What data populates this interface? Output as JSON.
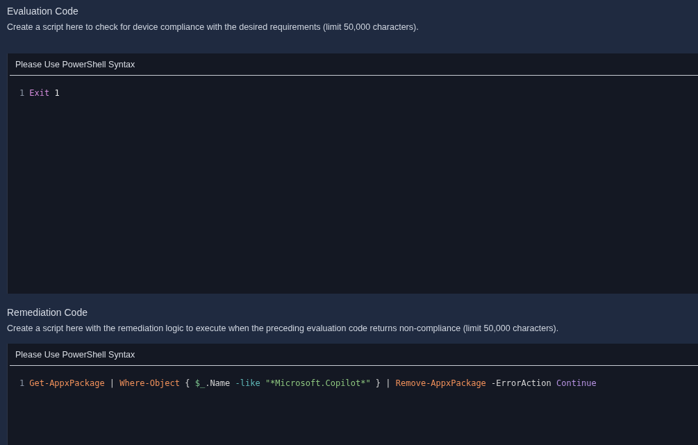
{
  "sections": [
    {
      "title": "Evaluation Code",
      "description": "Create a script here to check for device compliance with the desired requirements (limit 50,000 characters).",
      "editor": {
        "header": "Please Use PowerShell Syntax",
        "lines": [
          {
            "number": "1",
            "words": [
              [
                {
                  "kind": "keyword",
                  "text": "Exit"
                }
              ],
              [
                {
                  "kind": "number",
                  "text": "1"
                }
              ]
            ]
          }
        ]
      }
    },
    {
      "title": "Remediation Code",
      "description": "Create a script here with the remediation logic to execute when the preceding evaluation code returns non-compliance (limit 50,000 characters).",
      "editor": {
        "header": "Please Use PowerShell Syntax",
        "lines": [
          {
            "number": "1",
            "words": [
              [
                {
                  "kind": "cmdlet",
                  "text": "Get-AppxPackage"
                }
              ],
              [
                {
                  "kind": "plain",
                  "text": "|"
                }
              ],
              [
                {
                  "kind": "cmdlet",
                  "text": "Where-Object"
                }
              ],
              [
                {
                  "kind": "plain",
                  "text": "{"
                }
              ],
              [
                {
                  "kind": "variable",
                  "text": "$_"
                },
                {
                  "kind": "plain",
                  "text": ".Name"
                }
              ],
              [
                {
                  "kind": "operator",
                  "text": "-like"
                }
              ],
              [
                {
                  "kind": "string",
                  "text": "\"*Microsoft.Copilot*\""
                }
              ],
              [
                {
                  "kind": "plain",
                  "text": "}"
                }
              ],
              [
                {
                  "kind": "plain",
                  "text": "|"
                }
              ],
              [
                {
                  "kind": "cmdlet",
                  "text": "Remove-AppxPackage"
                }
              ],
              [
                {
                  "kind": "plain",
                  "text": "-ErrorAction"
                }
              ],
              [
                {
                  "kind": "value",
                  "text": "Continue"
                }
              ]
            ]
          }
        ]
      }
    }
  ]
}
